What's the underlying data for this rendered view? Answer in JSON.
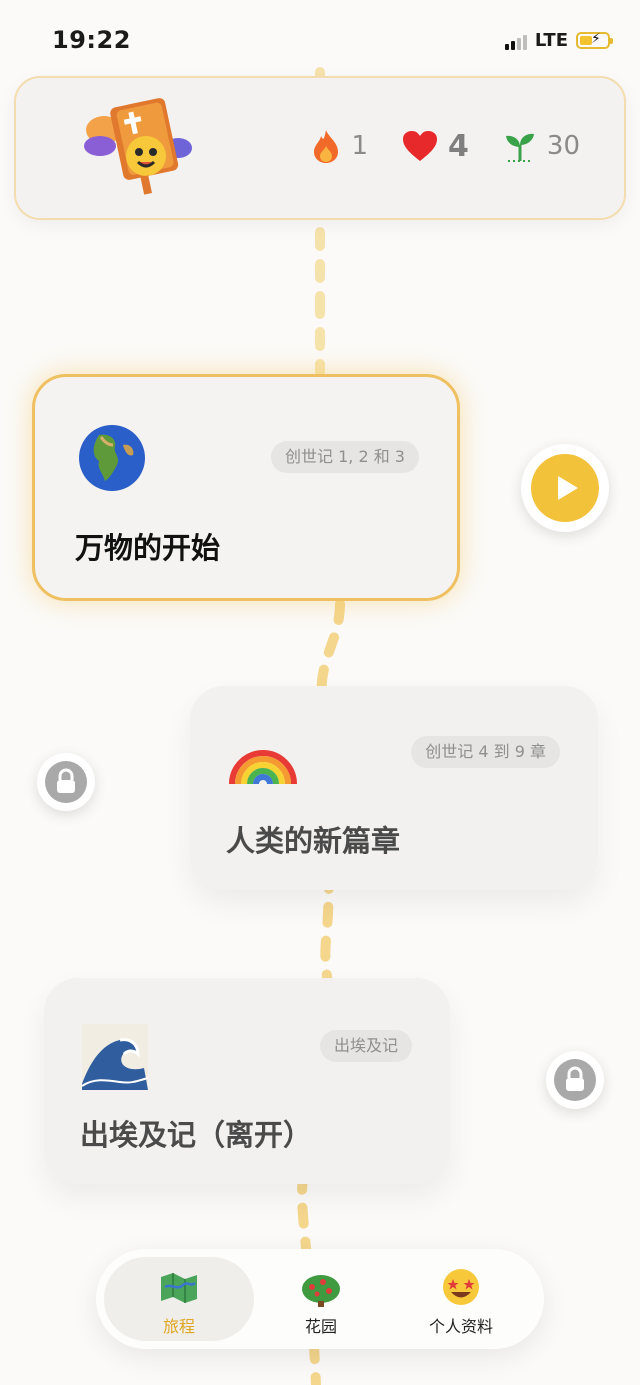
{
  "status_bar": {
    "time": "19:22",
    "network": "LTE",
    "icons": [
      "signal-icon",
      "battery-charging-icon"
    ]
  },
  "header": {
    "mascot": "bible-mascot-icon",
    "stats": [
      {
        "icon": "fire-icon",
        "value": "1"
      },
      {
        "icon": "heart-icon",
        "value": "4"
      },
      {
        "icon": "sprout-icon",
        "value": "30"
      }
    ]
  },
  "journey": [
    {
      "icon": "globe-icon",
      "badge": "创世记 1, 2 和 3",
      "title": "万物的开始",
      "state": "active"
    },
    {
      "icon": "rainbow-icon",
      "badge": "创世记 4 到 9 章",
      "title": "人类的新篇章",
      "state": "locked"
    },
    {
      "icon": "wave-icon",
      "badge": "出埃及记",
      "title": "出埃及记（离开）",
      "state": "locked"
    }
  ],
  "tabbar": {
    "tabs": [
      {
        "icon": "map-icon",
        "label": "旅程",
        "selected": true
      },
      {
        "icon": "garden-bush-icon",
        "label": "花园",
        "selected": false
      },
      {
        "icon": "star-struck-face-icon",
        "label": "个人资料",
        "selected": false
      }
    ]
  },
  "colors": {
    "accent": "#f2c23b",
    "selected_tab_label": "#e0a723",
    "lock": "#a9a9a9",
    "path": "#f5d98a"
  }
}
